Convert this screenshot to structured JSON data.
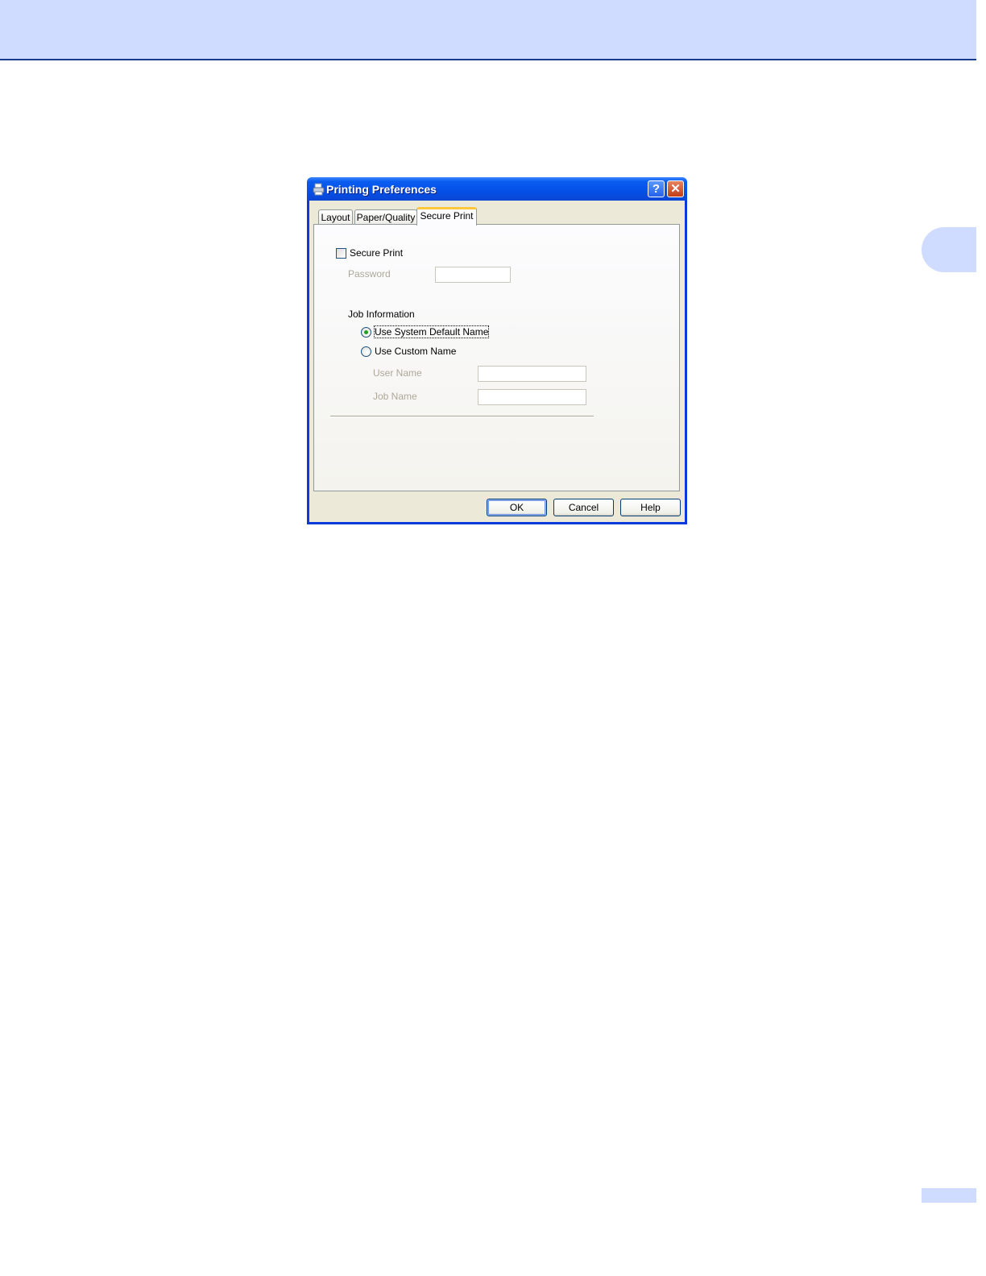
{
  "dialog": {
    "title": "Printing Preferences",
    "help_button": "?",
    "close_button": "✕"
  },
  "tabs": [
    {
      "label": "Layout"
    },
    {
      "label": "Paper/Quality"
    },
    {
      "label": "Secure Print",
      "active": true
    }
  ],
  "secure_print": {
    "checkbox_label": "Secure Print",
    "checked": false,
    "password_label": "Password",
    "password_value": ""
  },
  "job_information": {
    "group_label": "Job Information",
    "option_default": "Use System Default Name",
    "option_custom": "Use Custom Name",
    "selected": "default",
    "user_name_label": "User Name",
    "user_name_value": "",
    "job_name_label": "Job Name",
    "job_name_value": ""
  },
  "buttons": {
    "ok": "OK",
    "cancel": "Cancel",
    "help": "Help"
  },
  "colors": {
    "header_band": "#cfdcff",
    "titlebar": "#0550e6",
    "dialog_face": "#ece9d8",
    "radio_dot": "#21a121"
  }
}
